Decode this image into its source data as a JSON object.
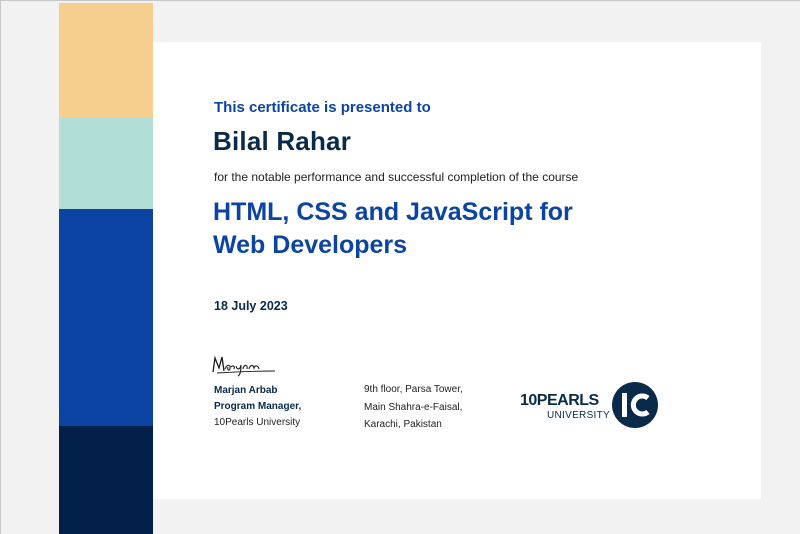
{
  "certificate": {
    "presented_to": "This certificate is presented to",
    "recipient_name": "Bilal Rahar",
    "performance_text": "for the notable performance and successful completion of the course",
    "course_line1": "HTML, CSS and JavaScript for",
    "course_line2": "Web Developers",
    "date": "18 July 2023"
  },
  "signatory": {
    "name": "Marjan Arbab",
    "role": "Program Manager,",
    "organization": "10Pearls University",
    "signature_text": "Marjan"
  },
  "address": {
    "line1": "9th floor, Parsa Tower,",
    "line2": "Main Shahra-e-Faisal,",
    "line3": "Karachi, Pakistan"
  },
  "logo": {
    "top_text": "10PEARLS",
    "bottom_text": "UNIVERSITY",
    "mark_text": "10"
  },
  "colors": {
    "band_yellow": "#f6cf8e",
    "band_teal": "#b2ded8",
    "band_blue": "#0c44a4",
    "band_navy": "#03204a",
    "accent_blue": "#0c44a4",
    "dark_navy": "#0a2a4a"
  }
}
